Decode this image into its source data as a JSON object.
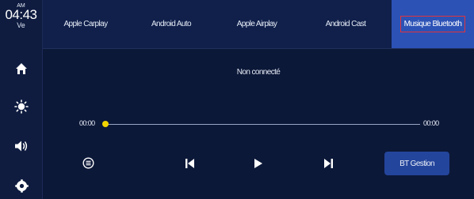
{
  "clock": {
    "ampm": "AM",
    "time": "04:43",
    "day": "Ve"
  },
  "sidebar": {
    "items": [
      {
        "icon": "home-icon"
      },
      {
        "icon": "brightness-icon"
      },
      {
        "icon": "volume-icon"
      },
      {
        "icon": "settings-icon"
      }
    ]
  },
  "tabs": [
    {
      "label": "Apple Carplay",
      "active": false
    },
    {
      "label": "Android Auto",
      "active": false
    },
    {
      "label": "Apple Airplay",
      "active": false
    },
    {
      "label": "Android Cast",
      "active": false
    },
    {
      "label": "Musique Bluetooth",
      "active": true
    }
  ],
  "player": {
    "status": "Non connecté",
    "elapsed": "00:00",
    "duration": "00:00",
    "progress": 0,
    "bt_button_label": "BT Gestion"
  },
  "colors": {
    "accent": "#2c52b6",
    "active_tab_outline": "#e0343c",
    "progress_knob": "#f2d400",
    "background": "#0b1633"
  }
}
